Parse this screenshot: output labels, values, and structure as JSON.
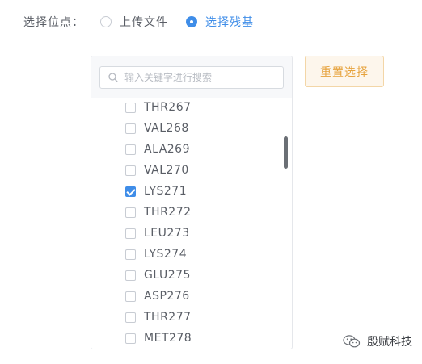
{
  "form": {
    "field_label": "选择位点：",
    "options": [
      {
        "label": "上传文件",
        "checked": false
      },
      {
        "label": "选择残基",
        "checked": true
      }
    ]
  },
  "search": {
    "placeholder": "输入关键字进行搜索"
  },
  "residues": [
    {
      "label": "THR267",
      "checked": false
    },
    {
      "label": "VAL268",
      "checked": false
    },
    {
      "label": "ALA269",
      "checked": false
    },
    {
      "label": "VAL270",
      "checked": false
    },
    {
      "label": "LYS271",
      "checked": true
    },
    {
      "label": "THR272",
      "checked": false
    },
    {
      "label": "LEU273",
      "checked": false
    },
    {
      "label": "LYS274",
      "checked": false
    },
    {
      "label": "GLU275",
      "checked": false
    },
    {
      "label": "ASP276",
      "checked": false
    },
    {
      "label": "THR277",
      "checked": false
    },
    {
      "label": "MET278",
      "checked": false
    }
  ],
  "reset_button": {
    "label": "重置选择"
  },
  "watermark": {
    "text": "殷赋科技"
  },
  "colors": {
    "accent": "#3f8de8",
    "warning": "#e6a23c"
  }
}
